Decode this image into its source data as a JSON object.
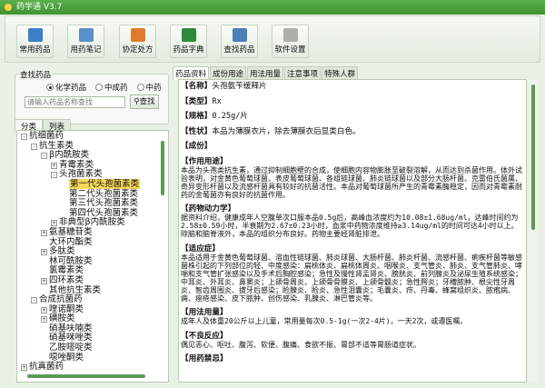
{
  "window": {
    "title": "药学通 V3.7"
  },
  "toolbar": [
    {
      "label": "常用药品",
      "icon": "id-card-icon",
      "color": "#3c7fc6"
    },
    {
      "label": "用药笔记",
      "icon": "notebook-icon",
      "color": "#5a8fc9"
    },
    {
      "label": "协定处方",
      "icon": "chart-icon",
      "color": "#e07b2d"
    },
    {
      "label": "药品字典",
      "icon": "book-icon",
      "color": "#2f8a3a"
    },
    {
      "label": "查找药品",
      "icon": "magnifier-icon",
      "color": "#4a7fb8"
    },
    {
      "label": "软件设置",
      "icon": "gear-icon",
      "color": "#aab0a8"
    }
  ],
  "search": {
    "legend": "查找药品",
    "options": [
      "化学药品",
      "中成药",
      "中药"
    ],
    "selected": 0,
    "placeholder": "请输入药品名称查找",
    "button": "查找"
  },
  "left_tabs": [
    "分类",
    "列表"
  ],
  "tree": [
    {
      "l": "抗细菌药",
      "d": 0,
      "e": "-"
    },
    {
      "l": "抗生素类",
      "d": 1,
      "e": "-"
    },
    {
      "l": "β内酰胺类",
      "d": 2,
      "e": "-"
    },
    {
      "l": "青霉素类",
      "d": 3,
      "e": "+"
    },
    {
      "l": "头孢菌素类",
      "d": 3,
      "e": "-"
    },
    {
      "l": "第一代头孢菌素类",
      "d": 4,
      "e": "",
      "sel": true
    },
    {
      "l": "第二代头孢菌素类",
      "d": 4,
      "e": ""
    },
    {
      "l": "第三代头孢菌素类",
      "d": 4,
      "e": ""
    },
    {
      "l": "第四代头孢菌素类",
      "d": 4,
      "e": ""
    },
    {
      "l": "非典型β内酰胺类",
      "d": 3,
      "e": "+"
    },
    {
      "l": "氨基糖苷类",
      "d": 2,
      "e": "+"
    },
    {
      "l": "大环内酯类",
      "d": 2,
      "e": ""
    },
    {
      "l": "多肽类",
      "d": 2,
      "e": "+"
    },
    {
      "l": "林可酰胺类",
      "d": 2,
      "e": ""
    },
    {
      "l": "氯霉素类",
      "d": 2,
      "e": ""
    },
    {
      "l": "四环素类",
      "d": 2,
      "e": "+"
    },
    {
      "l": "其他抗生素类",
      "d": 2,
      "e": ""
    },
    {
      "l": "合成抗菌药",
      "d": 1,
      "e": "-"
    },
    {
      "l": "喹诺酮类",
      "d": 2,
      "e": "+"
    },
    {
      "l": "磺胺类",
      "d": 2,
      "e": "+"
    },
    {
      "l": "硝基呋喃类",
      "d": 2,
      "e": ""
    },
    {
      "l": "硝基咪唑类",
      "d": 2,
      "e": ""
    },
    {
      "l": "乙胺嘧啶类",
      "d": 2,
      "e": ""
    },
    {
      "l": "噁唑酮类",
      "d": 2,
      "e": ""
    },
    {
      "l": "抗真菌药",
      "d": 0,
      "e": "+"
    }
  ],
  "right_tabs": [
    "药品资料",
    "成份用途",
    "用法用量",
    "注意事项",
    "特殊人群"
  ],
  "content": [
    {
      "head": "【名称】",
      "text": "头孢氨苄缓释片"
    },
    {
      "head": "【类型】",
      "text": "Rx"
    },
    {
      "head": "【规格】",
      "text": "0.25g/片"
    },
    {
      "head": "【性状】",
      "text": "本品为薄膜衣片，除去薄膜衣后显类白色。"
    },
    {
      "head": "【成份】",
      "text": ""
    },
    {
      "head": "【作用用途】",
      "body": "本品为头孢类抗生素，通过抑制细胞壁的合成，使细胞内容物膨胀至破裂溶解，从而达到杀菌作用。体外试验表明，对金黄色葡萄球菌、表皮葡萄球菌、各组链球菌、肺炎链球菌以及部分大肠杆菌、克雷伯氏菌属、奇异变形杆菌以及流感杆菌具有较好的抗菌活性。本品对葡萄球菌所产生的青霉素酶稳定，因而对青霉素耐药的金葡菌亦有良好的抗菌作用。"
    },
    {
      "head": "【药物动力学】",
      "body": "据资料介绍，健康成年人空腹单次口服本品0.5g后，高峰血浓度约为10.08±1.68ug/ml，达峰时间约为2.58±0.59小时，半衰期为2.67±0.23小时，血浆中药物浓度维持≥3.14ug/ml的时间可达4小时以上。除脑和脑脊液外，本品的组织分布良好。药物主要经肾脏排泄。"
    },
    {
      "head": "【适应症】",
      "body": "本品适用于金黄色葡萄球菌、溶血性链球菌、肺炎球菌、大肠杆菌、肺炎杆菌、流感杆菌、痢疾杆菌等敏感菌株引起的下列部位的轻、中度感染：扁桃体炎、扁桃体周炎、咽喉炎、支气管炎、肺炎、支气管肺炎、哮喘和支气管扩张感染以及手术后胸腔感染；急性及慢性肾盂肾炎、膀胱炎、前列腺炎及泌尿生殖系统感染；中耳炎、外耳炎、鼻窦炎；上颌骨周炎、上颌骨骨膜炎、上颌骨髓炎；急性腭炎；牙槽脓肿、根尖性牙周炎、智齿周围炎、拔牙后感染；睑腺炎、睑炎、急性泪囊炎；毛囊炎、疖、丹毒、蜂窝组织炎、脓疱病、痈、痤疮感染、皮下脓肿、创伤感染、乳腺炎、淋巴管炎等。"
    },
    {
      "head": "【用法用量】",
      "body": "成年人及体重20公斤以上儿童，常用量每次0.5-1g(一次2-4片)，一天2次，或遵医嘱。"
    },
    {
      "head": "【不良反应】",
      "body": "偶见恶心、呕吐、腹泻、软便、腹痛、食欲不振、胃部不适等胃肠道症状。"
    },
    {
      "head": "【用药禁忌】",
      "body": ""
    }
  ]
}
